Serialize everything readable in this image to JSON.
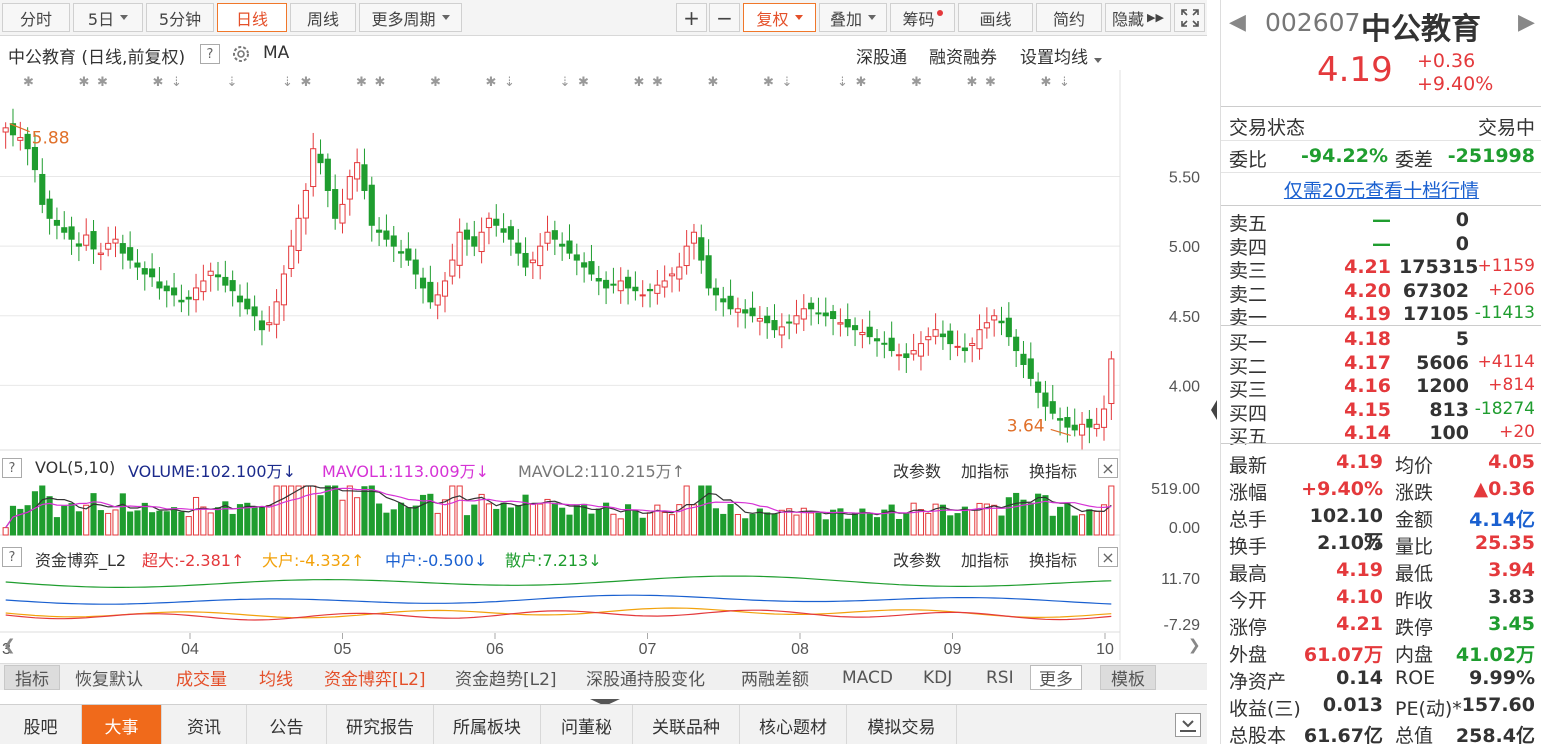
{
  "toolbar": {
    "items": [
      "分时",
      "5日",
      "5分钟",
      "日线",
      "周线",
      "更多周期"
    ],
    "active": "日线",
    "plus": "+",
    "minus": "−",
    "fuquan": "复权",
    "overlay": "叠加",
    "chips": "筹码",
    "draw": "画线",
    "simple": "简约",
    "hide": "隐藏"
  },
  "chart_header": {
    "title": "中公教育 (日线,前复权)",
    "help": "?",
    "ma": "MA",
    "links": [
      "深股通",
      "融资融券",
      "设置均线"
    ]
  },
  "chart_data": {
    "type": "candlestick",
    "title": "中公教育 (日线,前复权)",
    "y_ticks": [
      5.5,
      5.0,
      4.5,
      4.0
    ],
    "ylim": [
      3.55,
      6.05
    ],
    "x_ticks": [
      "04",
      "05",
      "06",
      "07",
      "08",
      "09",
      "10"
    ],
    "annotations": [
      {
        "text": "5.88",
        "kind": "high"
      },
      {
        "text": "3.64",
        "kind": "low"
      }
    ],
    "close_series": [
      5.85,
      5.8,
      5.78,
      5.7,
      5.55,
      5.3,
      5.2,
      5.15,
      5.1,
      5.05,
      5.0,
      5.08,
      4.98,
      4.95,
      5.02,
      5.05,
      4.95,
      4.9,
      4.85,
      4.8,
      4.78,
      4.7,
      4.68,
      4.65,
      4.6,
      4.62,
      4.7,
      4.75,
      4.82,
      4.78,
      4.72,
      4.68,
      4.6,
      4.55,
      4.5,
      4.4,
      4.45,
      4.6,
      4.8,
      5.0,
      5.2,
      5.4,
      5.7,
      5.6,
      5.4,
      5.2,
      5.3,
      5.5,
      5.6,
      5.4,
      5.15,
      5.1,
      5.05,
      5.0,
      4.95,
      4.9,
      4.8,
      4.7,
      4.6,
      4.65,
      4.75,
      4.9,
      5.1,
      5.05,
      5.0,
      5.1,
      5.2,
      5.15,
      5.1,
      5.05,
      4.95,
      4.85,
      4.9,
      5.0,
      5.1,
      5.05,
      5.0,
      4.95,
      4.9,
      4.85,
      4.8,
      4.75,
      4.7,
      4.72,
      4.75,
      4.7,
      4.68,
      4.65,
      4.68,
      4.72,
      4.75,
      4.8,
      4.85,
      5.0,
      5.1,
      4.9,
      4.7,
      4.65,
      4.6,
      4.55,
      4.55,
      4.52,
      4.5,
      4.48,
      4.45,
      4.4,
      4.42,
      4.45,
      4.5,
      4.55,
      4.55,
      4.52,
      4.5,
      4.48,
      4.45,
      4.42,
      4.4,
      4.38,
      4.35,
      4.32,
      4.3,
      4.25,
      4.22,
      4.2,
      4.25,
      4.3,
      4.35,
      4.4,
      4.35,
      4.3,
      4.28,
      4.25,
      4.3,
      4.4,
      4.45,
      4.5,
      4.45,
      4.35,
      4.25,
      4.15,
      4.05,
      3.95,
      3.85,
      3.8,
      3.75,
      3.7,
      3.68,
      3.72,
      3.7,
      3.72,
      3.83,
      4.19
    ],
    "volume_ticks": [
      "519.00",
      "0.00"
    ],
    "fund_ticks": [
      "11.70",
      "-7.29"
    ]
  },
  "vol_panel": {
    "help": "?",
    "name": "VOL(5,10)",
    "volume": "VOLUME:102.100万",
    "volume_arrow": "↓",
    "mavol1": "MAVOL1:113.009万",
    "mavol1_arrow": "↓",
    "mavol2": "MAVOL2:110.215万",
    "mavol2_arrow": "↑",
    "actions": [
      "改参数",
      "加指标",
      "换指标"
    ],
    "close": "×"
  },
  "fund_panel": {
    "help": "?",
    "name": "资金博弈_L2",
    "super": "超大:-2.381",
    "super_arrow": "↑",
    "large": "大户:-4.332",
    "large_arrow": "↑",
    "mid": "中户:-0.500",
    "mid_arrow": "↓",
    "retail": "散户:7.213",
    "retail_arrow": "↓",
    "actions": [
      "改参数",
      "加指标",
      "换指标"
    ],
    "close": "×"
  },
  "indicator_bar": [
    "指标",
    "恢复默认",
    "成交量",
    "均线",
    "资金博弈[L2]",
    "资金趋势[L2]",
    "深股通持股变化",
    "两融差额",
    "MACD",
    "KDJ",
    "RSI",
    "更多",
    "模板"
  ],
  "bottom_tabs": [
    "股吧",
    "大事",
    "资讯",
    "公告",
    "研究报告",
    "所属板块",
    "问董秘",
    "关联品种",
    "核心题材",
    "模拟交易"
  ],
  "bottom_active": "大事",
  "quote": {
    "code": "002607",
    "name": "中公教育",
    "price": "4.19",
    "change": "+0.36",
    "change_pct": "+9.40%",
    "status_label": "交易状态",
    "status_value": "交易中",
    "weibi_label": "委比",
    "weibi_value": "-94.22%",
    "weicha_label": "委差",
    "weicha_value": "-251998",
    "promo": "仅需20元查看十档行情",
    "asks": [
      {
        "label": "卖五",
        "price": "—",
        "vol": "0",
        "chg": ""
      },
      {
        "label": "卖四",
        "price": "—",
        "vol": "0",
        "chg": ""
      },
      {
        "label": "卖三",
        "price": "4.21",
        "vol": "175315",
        "chg": "+1159"
      },
      {
        "label": "卖二",
        "price": "4.20",
        "vol": "67302",
        "chg": "+206"
      },
      {
        "label": "卖一",
        "price": "4.19",
        "vol": "17105",
        "chg": "-11413"
      }
    ],
    "bids": [
      {
        "label": "买一",
        "price": "4.18",
        "vol": "5",
        "chg": ""
      },
      {
        "label": "买二",
        "price": "4.17",
        "vol": "5606",
        "chg": "+4114"
      },
      {
        "label": "买三",
        "price": "4.16",
        "vol": "1200",
        "chg": "+814"
      },
      {
        "label": "买四",
        "price": "4.15",
        "vol": "813",
        "chg": "-18274"
      },
      {
        "label": "买五",
        "price": "4.14",
        "vol": "100",
        "chg": "+20"
      }
    ],
    "stats": [
      {
        "l1": "最新",
        "v1": "4.19",
        "c1": "red",
        "l2": "均价",
        "v2": "4.05",
        "c2": "red"
      },
      {
        "l1": "涨幅",
        "v1": "+9.40%",
        "c1": "red",
        "l2": "涨跌",
        "v2": "▲0.36",
        "c2": "red"
      },
      {
        "l1": "总手",
        "v1": "102.10万",
        "c1": "",
        "l2": "金额",
        "v2": "4.14亿",
        "c2": "blue"
      },
      {
        "l1": "换手",
        "v1": "2.10%",
        "c1": "",
        "l2": "量比",
        "v2": "25.35",
        "c2": "red"
      },
      {
        "l1": "最高",
        "v1": "4.19",
        "c1": "red",
        "l2": "最低",
        "v2": "3.94",
        "c2": "red"
      },
      {
        "l1": "今开",
        "v1": "4.10",
        "c1": "red",
        "l2": "昨收",
        "v2": "3.83",
        "c2": ""
      },
      {
        "l1": "涨停",
        "v1": "4.21",
        "c1": "red",
        "l2": "跌停",
        "v2": "3.45",
        "c2": "green"
      },
      {
        "l1": "外盘",
        "v1": "61.07万",
        "c1": "red",
        "l2": "内盘",
        "v2": "41.02万",
        "c2": "green"
      },
      {
        "l1": "净资产",
        "v1": "0.14",
        "c1": "",
        "l2": "ROE",
        "v2": "9.99%",
        "c2": ""
      },
      {
        "l1": "收益(三)",
        "v1": "0.013",
        "c1": "",
        "l2": "PE(动)*",
        "v2": "157.60",
        "c2": ""
      },
      {
        "l1": "总股本",
        "v1": "61.67亿",
        "c1": "",
        "l2": "总值",
        "v2": "258.4亿",
        "c2": ""
      }
    ]
  },
  "colors": {
    "up": "#e4393c",
    "down": "#1f9d2f",
    "accent": "#f06a1b",
    "ma5": "#333333",
    "ma10": "#d633d6"
  }
}
